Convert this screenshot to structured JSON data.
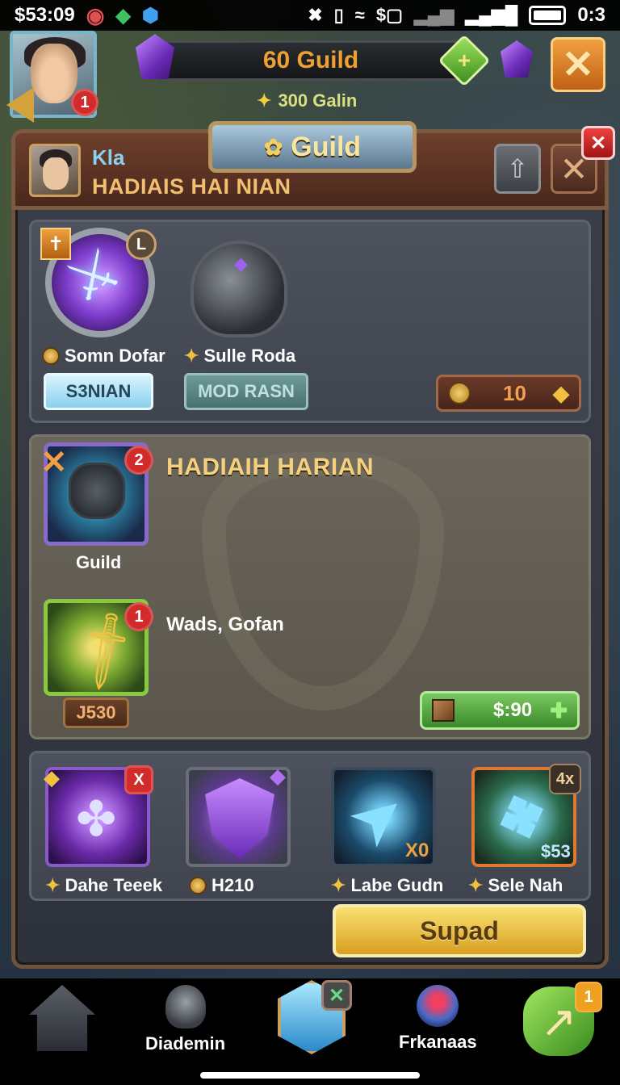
{
  "status_bar": {
    "time": "$53:09",
    "right_text": "0:3"
  },
  "hud": {
    "avatar_badge": "1",
    "guild_currency": "60 Guild",
    "galin": "300 Galin"
  },
  "panel": {
    "title": "Guild",
    "player_name": "Kla",
    "player_sub": "HADIAIS HAI NIAN"
  },
  "section1": {
    "item1": {
      "badge": "L",
      "label": "Somn Dofar",
      "button": "S3NIAN"
    },
    "item2": {
      "label": "Sulle Roda",
      "button": "MOD RASN"
    },
    "price": "10"
  },
  "section2": {
    "title": "HADIAIH HARIAN",
    "card1": {
      "badge": "2",
      "label": "Guild"
    },
    "card2": {
      "badge": "1",
      "tag": "J530"
    },
    "subtitle": "Wads, Gofan",
    "buy_price": "$:90"
  },
  "section3": {
    "cards": [
      {
        "label": "Dahe Teeek",
        "corner": "X"
      },
      {
        "label": "H210"
      },
      {
        "label": "Labe Gudn",
        "overlay": "X0"
      },
      {
        "label": "Sele Nah",
        "corner": "4x",
        "overlay": "$53"
      }
    ],
    "action_button": "Supad"
  },
  "bottom_nav": {
    "items": [
      {
        "label": ""
      },
      {
        "label": "Diademin"
      },
      {
        "label": ""
      },
      {
        "label": "Frkanaas"
      },
      {
        "label": "",
        "badge": "1"
      }
    ]
  }
}
